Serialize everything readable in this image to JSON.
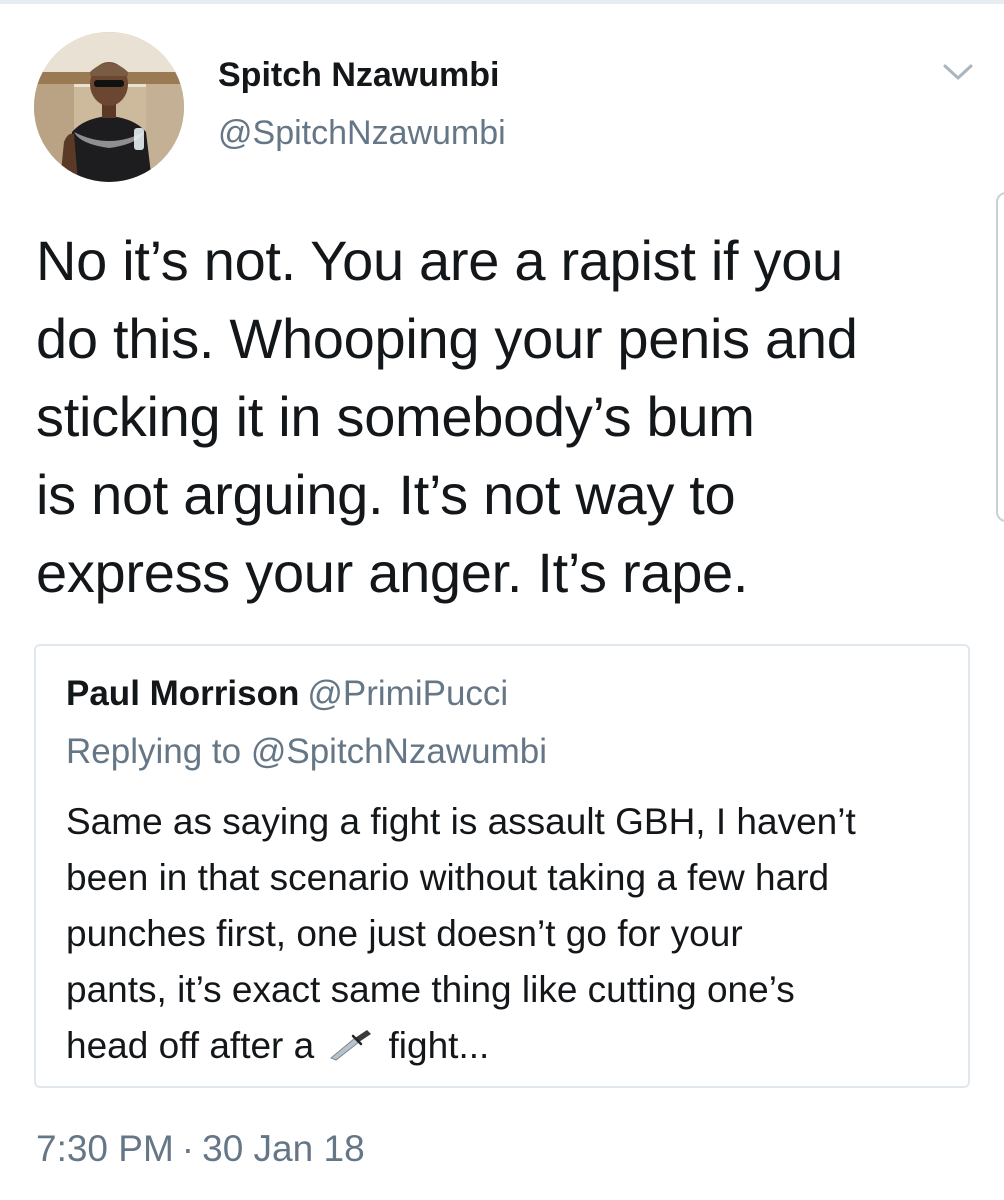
{
  "author": {
    "name": "Spitch Nzawumbi",
    "handle": "@SpitchNzawumbi"
  },
  "tweet": {
    "lines": [
      "No it’s not. You are a rapist if you",
      "do this. Whooping your penis and",
      "sticking it in somebody’s bum",
      "is not arguing. It’s not way to",
      "express your anger. It’s rape."
    ]
  },
  "quoted": {
    "name": "Paul Morrison",
    "handle": "@PrimiPucci",
    "replying_to": "Replying to @SpitchNzawumbi",
    "lines": [
      "Same as saying a fight is assault GBH, I haven’t",
      "been in that scenario without taking a few hard",
      "punches first, one just doesn’t go for your",
      "pants, it’s exact same thing like cutting one’s"
    ],
    "last_line_before_icon": "head off after a",
    "last_line_icon": "knife-icon",
    "last_line_after_icon": "fight..."
  },
  "meta": {
    "time": "7:30 PM",
    "separator": "·",
    "date": "30 Jan 18"
  },
  "colors": {
    "text": "#14171a",
    "secondary": "#657786",
    "border": "#e1e8ed"
  }
}
